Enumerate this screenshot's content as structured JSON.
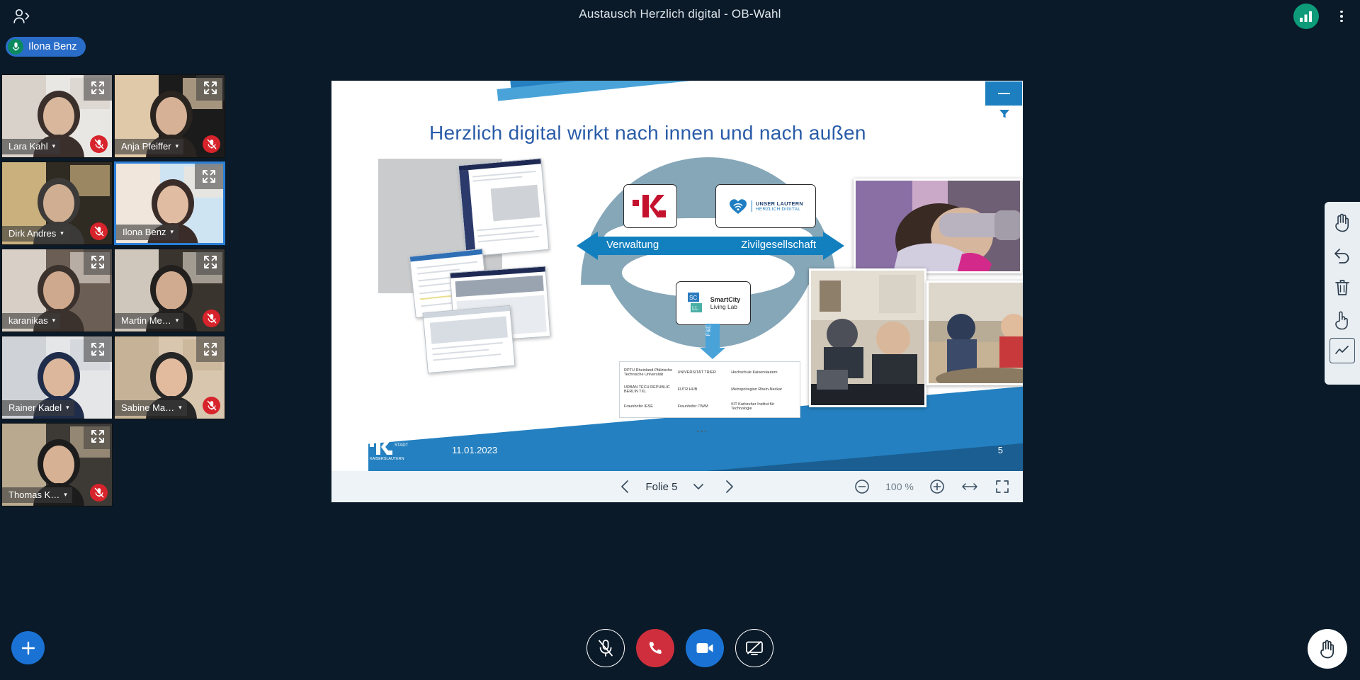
{
  "topbar": {
    "title": "Austausch Herzlich digital - OB-Wahl",
    "participants_icon": "participants-icon",
    "connection_icon": "signal-bars-icon",
    "options_icon": "kebab-menu-icon"
  },
  "speaker": {
    "name": "Ilona Benz",
    "icon": "microphone-icon",
    "color": "#2a6dc9"
  },
  "participants": [
    {
      "name": "Lara Kahl",
      "muted": true,
      "active": false,
      "expand": true
    },
    {
      "name": "Anja Pfeiffer",
      "muted": true,
      "active": false,
      "expand": true
    },
    {
      "name": "Dirk Andres",
      "muted": true,
      "active": false,
      "expand": false
    },
    {
      "name": "Ilona Benz",
      "muted": false,
      "active": true,
      "expand": true
    },
    {
      "name": "karanikas",
      "muted": false,
      "active": false,
      "expand": true
    },
    {
      "name": "Martin Me…",
      "muted": true,
      "active": false,
      "expand": true
    },
    {
      "name": "Rainer Kadel",
      "muted": false,
      "active": false,
      "expand": true
    },
    {
      "name": "Sabine Ma…",
      "muted": true,
      "active": false,
      "expand": true
    },
    {
      "name": "Thomas K…",
      "muted": true,
      "active": false,
      "expand": true
    }
  ],
  "presentation": {
    "minimize_label": "–",
    "filter_icon": "funnel-icon",
    "slide": {
      "title": "Herzlich digital wirkt nach innen und nach außen",
      "left_label": "Verwaltung",
      "right_label": "Zivilgesellschaft",
      "fe_label": "F&E",
      "logo_kl": "KL",
      "logo_unser_lautern_line1": "UNSER LAUTERN",
      "logo_unser_lautern_line2": "HERZLICH DIGITAL",
      "logo_smartcity_line1": "SmartCity",
      "logo_smartcity_line2": "Living Lab",
      "partners": [
        "RPTU Rheinland-Pfälzische Technische Universität",
        "UNIVERSITÄT TRIER",
        "Hochschule Kaiserslautern",
        "URBAN TECH REPUBLIC BERLIN TXL",
        "FUTR HUB",
        "Metropolregion Rhein-Neckar",
        "Fraunhofer IESE",
        "Fraunhofer ITWM",
        "KIT Karlsruher Institut für Technologie"
      ],
      "more_indicator": "…",
      "footer_logo": "KL STADT KAISERSLAUTERN",
      "date": "11.01.2023",
      "page_number": "5"
    },
    "toolbar": {
      "prev_icon": "chevron-left-icon",
      "next_icon": "chevron-right-icon",
      "slide_label": "Folie 5",
      "dropdown_icon": "chevron-down-icon",
      "zoom_out_icon": "zoom-out-icon",
      "zoom_level": "100 %",
      "zoom_in_icon": "zoom-in-icon",
      "fit_width_icon": "fit-width-icon",
      "fullscreen_icon": "fullscreen-icon"
    }
  },
  "tools": [
    {
      "name": "pan-tool",
      "icon": "hand-icon"
    },
    {
      "name": "undo-tool",
      "icon": "undo-arrow-icon"
    },
    {
      "name": "delete-tool",
      "icon": "trash-icon"
    },
    {
      "name": "pointer-tool",
      "icon": "pointer-hand-icon"
    },
    {
      "name": "line-tool",
      "icon": "line-chart-icon"
    }
  ],
  "controls": {
    "add_label": "+",
    "mute_icon": "microphone-muted-icon",
    "leave_icon": "phone-icon",
    "camera_icon": "camera-icon",
    "share_icon": "screen-share-icon",
    "raise_hand_icon": "raise-hand-icon"
  },
  "colors": {
    "background": "#0a1a29",
    "accent_blue": "#1a73d4",
    "speaking_border": "#2b7fd6",
    "mute_red": "#d7232b",
    "leave_red": "#cf2f3c",
    "signal_green": "#0e9b7a",
    "slide_title_blue": "#2a5ca8",
    "arrow_blue": "#1280bf",
    "arc_grey_blue": "#86a7b8"
  }
}
